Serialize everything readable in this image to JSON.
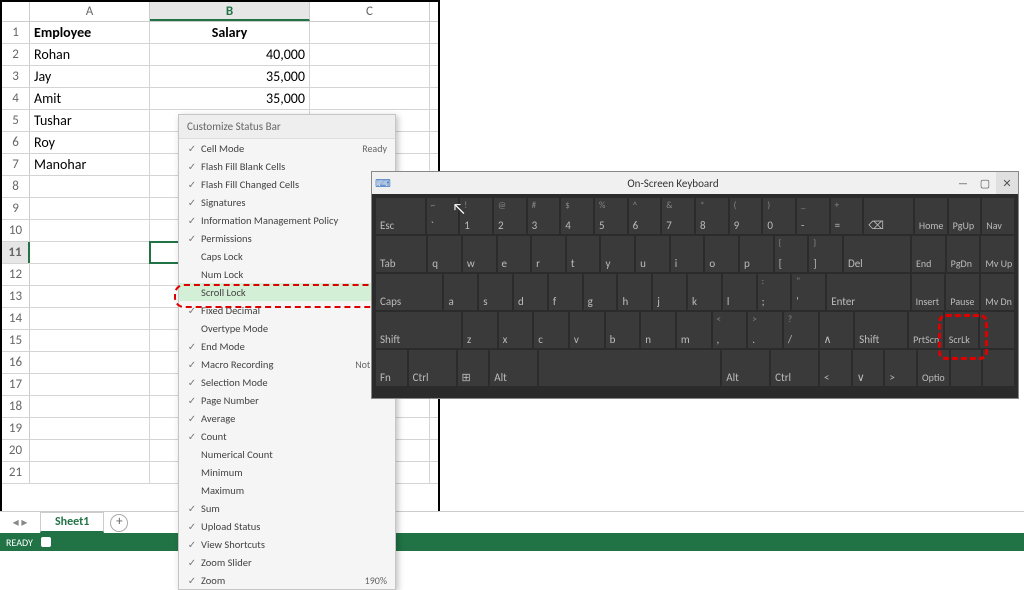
{
  "excel": {
    "cols": [
      "A",
      "B",
      "C"
    ],
    "activeCol": "B",
    "activeRow": 11,
    "headers": {
      "A": "Employee",
      "B": "Salary"
    },
    "rows": [
      {
        "n": 1,
        "A": "Employee",
        "B": "Salary",
        "hdr": true
      },
      {
        "n": 2,
        "A": "Rohan",
        "B": "40,000"
      },
      {
        "n": 3,
        "A": "Jay",
        "B": "35,000"
      },
      {
        "n": 4,
        "A": "Amit",
        "B": "35,000"
      },
      {
        "n": 5,
        "A": "Tushar",
        "B": ""
      },
      {
        "n": 6,
        "A": "Roy",
        "B": ""
      },
      {
        "n": 7,
        "A": "Manohar",
        "B": ""
      },
      {
        "n": 8
      },
      {
        "n": 9
      },
      {
        "n": 10
      },
      {
        "n": 11,
        "active": "B"
      },
      {
        "n": 12
      },
      {
        "n": 13
      },
      {
        "n": 14
      },
      {
        "n": 15
      },
      {
        "n": 16
      },
      {
        "n": 17
      },
      {
        "n": 18
      },
      {
        "n": 19
      },
      {
        "n": 20
      },
      {
        "n": 21
      }
    ],
    "sheet": "Sheet1",
    "status": "READY"
  },
  "menu": {
    "title": "Customize Status Bar",
    "items": [
      {
        "c": true,
        "l": "Cell Mode",
        "v": "Ready"
      },
      {
        "c": true,
        "l": "Flash Fill Blank Cells"
      },
      {
        "c": true,
        "l": "Flash Fill Changed Cells"
      },
      {
        "c": true,
        "l": "Signatures"
      },
      {
        "c": true,
        "l": "Information Management Policy"
      },
      {
        "c": true,
        "l": "Permissions"
      },
      {
        "c": false,
        "l": "Caps Lock"
      },
      {
        "c": false,
        "l": "Num Lock"
      },
      {
        "c": false,
        "l": "Scroll Lock",
        "hi": true
      },
      {
        "c": true,
        "l": "Fixed Decimal"
      },
      {
        "c": false,
        "l": "Overtype Mode"
      },
      {
        "c": true,
        "l": "End Mode"
      },
      {
        "c": true,
        "l": "Macro Recording",
        "v": "Not Rec"
      },
      {
        "c": true,
        "l": "Selection Mode"
      },
      {
        "c": true,
        "l": "Page Number"
      },
      {
        "c": true,
        "l": "Average"
      },
      {
        "c": true,
        "l": "Count"
      },
      {
        "c": false,
        "l": "Numerical Count"
      },
      {
        "c": false,
        "l": "Minimum"
      },
      {
        "c": false,
        "l": "Maximum"
      },
      {
        "c": true,
        "l": "Sum"
      },
      {
        "c": true,
        "l": "Upload Status"
      },
      {
        "c": true,
        "l": "View Shortcuts"
      },
      {
        "c": true,
        "l": "Zoom Slider"
      },
      {
        "c": true,
        "l": "Zoom",
        "v": "190%"
      }
    ]
  },
  "osk": {
    "title": "On-Screen Keyboard",
    "rows": [
      [
        {
          "l": "Esc",
          "w": "k15"
        },
        {
          "t": "~",
          "l": "`",
          "w": "k1"
        },
        {
          "t": "!",
          "l": "1",
          "w": "k1"
        },
        {
          "t": "@",
          "l": "2",
          "w": "k1"
        },
        {
          "t": "#",
          "l": "3",
          "w": "k1"
        },
        {
          "t": "$",
          "l": "4",
          "w": "k1"
        },
        {
          "t": "%",
          "l": "5",
          "w": "k1"
        },
        {
          "t": "^",
          "l": "6",
          "w": "k1"
        },
        {
          "t": "&",
          "l": "7",
          "w": "k1"
        },
        {
          "t": "*",
          "l": "8",
          "w": "k1"
        },
        {
          "t": "(",
          "l": "9",
          "w": "k1"
        },
        {
          "t": ")",
          "l": "0",
          "w": "k1"
        },
        {
          "t": "_",
          "l": "-",
          "w": "k1"
        },
        {
          "t": "+",
          "l": "=",
          "w": "k1"
        },
        {
          "l": "⌫",
          "w": "k15"
        },
        {
          "l": "Home",
          "w": "k1",
          "s": 1
        },
        {
          "l": "PgUp",
          "w": "k1",
          "s": 1
        },
        {
          "l": "Nav",
          "w": "k1",
          "s": 1
        }
      ],
      [
        {
          "l": "Tab",
          "w": "k15"
        },
        {
          "l": "q",
          "w": "k1"
        },
        {
          "l": "w",
          "w": "k1"
        },
        {
          "l": "e",
          "w": "k1"
        },
        {
          "l": "r",
          "w": "k1"
        },
        {
          "l": "t",
          "w": "k1"
        },
        {
          "l": "y",
          "w": "k1"
        },
        {
          "l": "u",
          "w": "k1"
        },
        {
          "l": "i",
          "w": "k1"
        },
        {
          "l": "o",
          "w": "k1"
        },
        {
          "l": "p",
          "w": "k1"
        },
        {
          "t": "{",
          "l": "[",
          "w": "k1"
        },
        {
          "t": "}",
          "l": "]",
          "w": "k1"
        },
        {
          "l": "Del",
          "w": "k2"
        },
        {
          "l": "End",
          "w": "k1",
          "s": 1
        },
        {
          "l": "PgDn",
          "w": "k1",
          "s": 1
        },
        {
          "l": "Mv Up",
          "w": "k1",
          "s": 1
        }
      ],
      [
        {
          "l": "Caps",
          "w": "k2"
        },
        {
          "l": "a",
          "w": "k1"
        },
        {
          "l": "s",
          "w": "k1"
        },
        {
          "l": "d",
          "w": "k1"
        },
        {
          "l": "f",
          "w": "k1"
        },
        {
          "l": "g",
          "w": "k1"
        },
        {
          "l": "h",
          "w": "k1"
        },
        {
          "l": "j",
          "w": "k1"
        },
        {
          "l": "k",
          "w": "k1"
        },
        {
          "l": "l",
          "w": "k1"
        },
        {
          "t": ":",
          "l": ";",
          "w": "k1"
        },
        {
          "t": "\"",
          "l": "'",
          "w": "k1"
        },
        {
          "l": "Enter",
          "w": "k25"
        },
        {
          "l": "Insert",
          "w": "k1",
          "s": 1
        },
        {
          "l": "Pause",
          "w": "k1",
          "s": 1
        },
        {
          "l": "Mv Dn",
          "w": "k1",
          "s": 1
        }
      ],
      [
        {
          "l": "Shift",
          "w": "k25"
        },
        {
          "l": "z",
          "w": "k1"
        },
        {
          "l": "x",
          "w": "k1"
        },
        {
          "l": "c",
          "w": "k1"
        },
        {
          "l": "v",
          "w": "k1"
        },
        {
          "l": "b",
          "w": "k1"
        },
        {
          "l": "n",
          "w": "k1"
        },
        {
          "l": "m",
          "w": "k1"
        },
        {
          "t": "<",
          "l": ",",
          "w": "k1"
        },
        {
          "t": ">",
          "l": ".",
          "w": "k1"
        },
        {
          "t": "?",
          "l": "/",
          "w": "k1"
        },
        {
          "l": "∧",
          "w": "k1"
        },
        {
          "l": "Shift",
          "w": "k15"
        },
        {
          "l": "PrtScn",
          "w": "k1",
          "s": 1
        },
        {
          "l": "ScrLk",
          "w": "k1",
          "s": 1,
          "hl": true
        },
        {
          "l": "",
          "w": "k1",
          "s": 1
        }
      ],
      [
        {
          "l": "Fn",
          "w": "k1"
        },
        {
          "l": "Ctrl",
          "w": "k15"
        },
        {
          "l": "⊞",
          "w": "k1"
        },
        {
          "l": "Alt",
          "w": "k15"
        },
        {
          "l": "",
          "w": "k6"
        },
        {
          "l": "Alt",
          "w": "k15"
        },
        {
          "l": "Ctrl",
          "w": "k15"
        },
        {
          "l": "<",
          "w": "k1"
        },
        {
          "l": "∨",
          "w": "k1"
        },
        {
          "l": ">",
          "w": "k1"
        },
        {
          "l": "Optio",
          "w": "k1",
          "s": 1
        },
        {
          "l": "",
          "w": "k1",
          "s": 1
        },
        {
          "l": "",
          "w": "k1",
          "s": 1
        }
      ]
    ]
  }
}
